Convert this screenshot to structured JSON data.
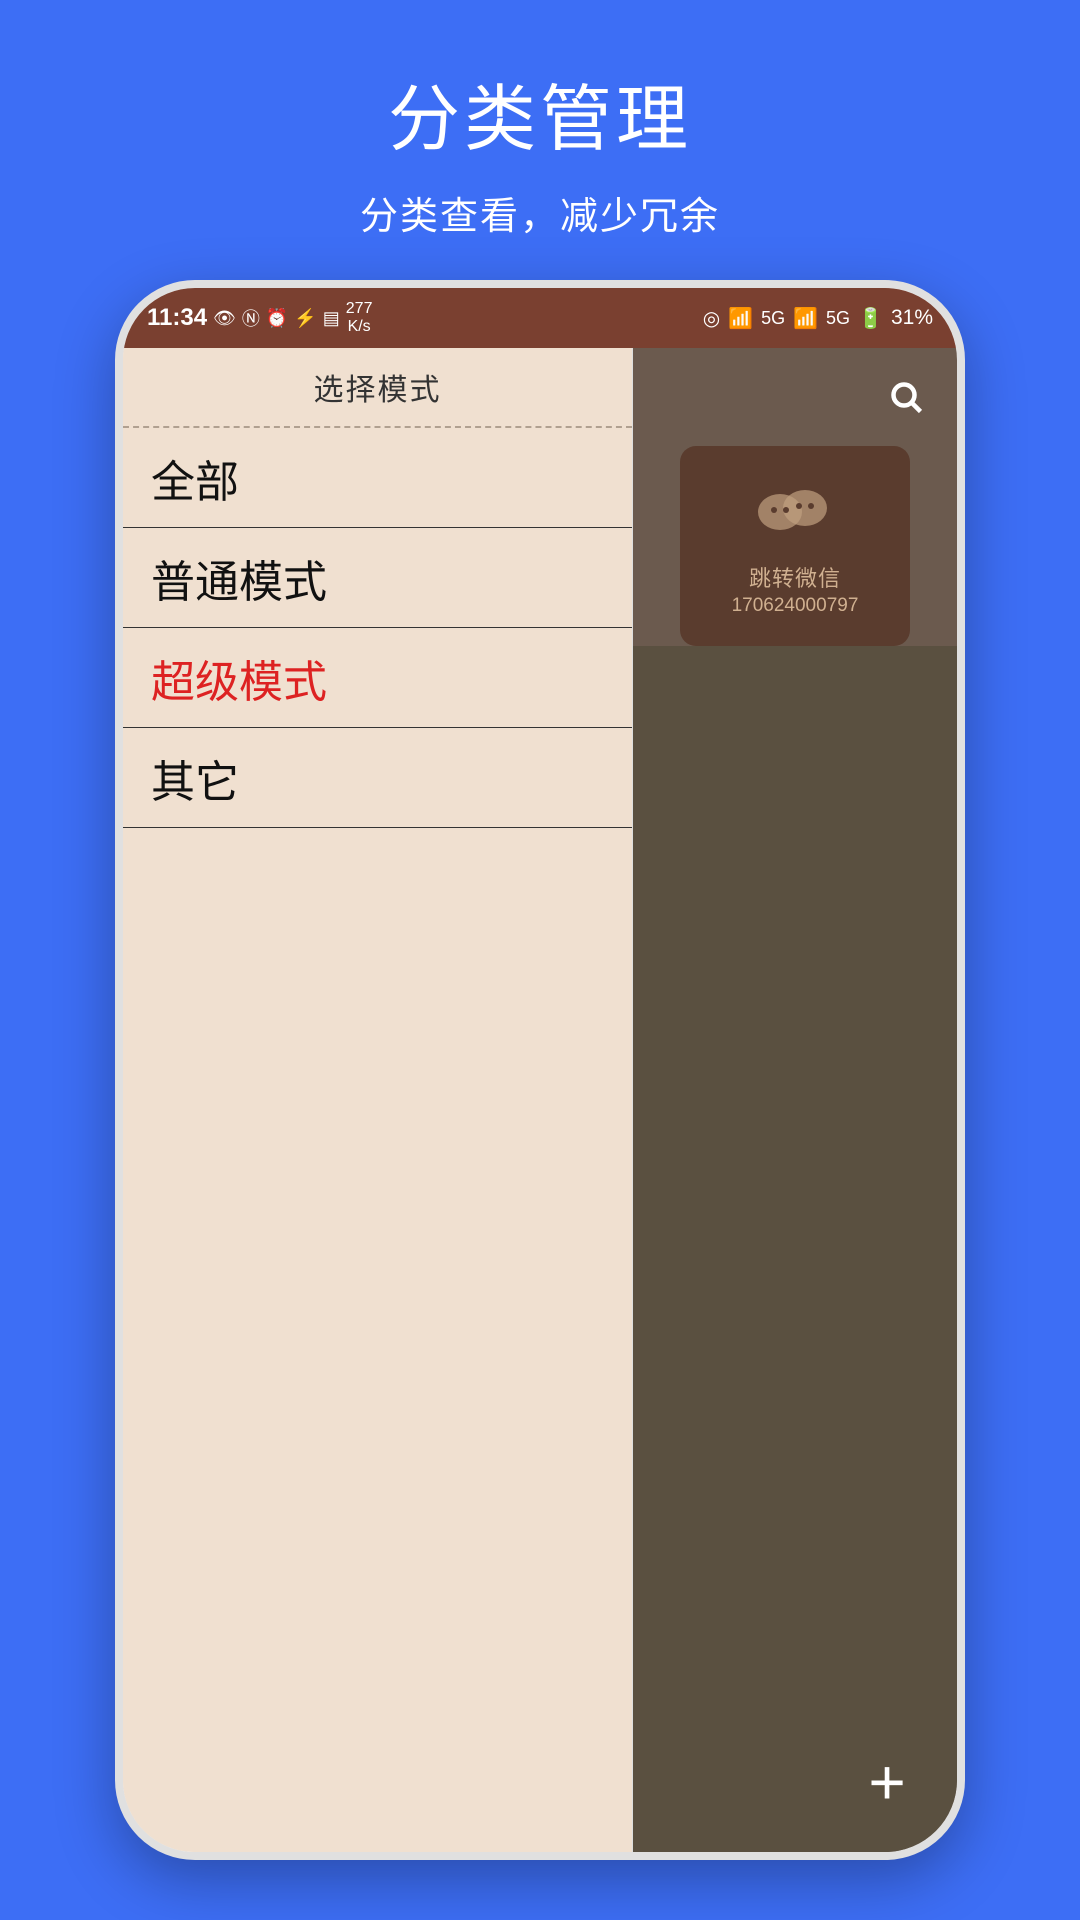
{
  "header": {
    "title": "分类管理",
    "subtitle": "分类查看，减少冗余"
  },
  "statusBar": {
    "time": "11:34",
    "speed": "277\nK/s",
    "battery": "31%"
  },
  "dropdown": {
    "label": "选择模式"
  },
  "menuItems": [
    {
      "id": "all",
      "label": "全部",
      "color": "normal"
    },
    {
      "id": "normal",
      "label": "普通模式",
      "color": "normal"
    },
    {
      "id": "super",
      "label": "超级模式",
      "color": "red"
    },
    {
      "id": "other",
      "label": "其它",
      "color": "normal"
    }
  ],
  "wechatCard": {
    "label": "跳转微信",
    "number": "170624000797"
  },
  "buttons": {
    "plus": "+"
  }
}
